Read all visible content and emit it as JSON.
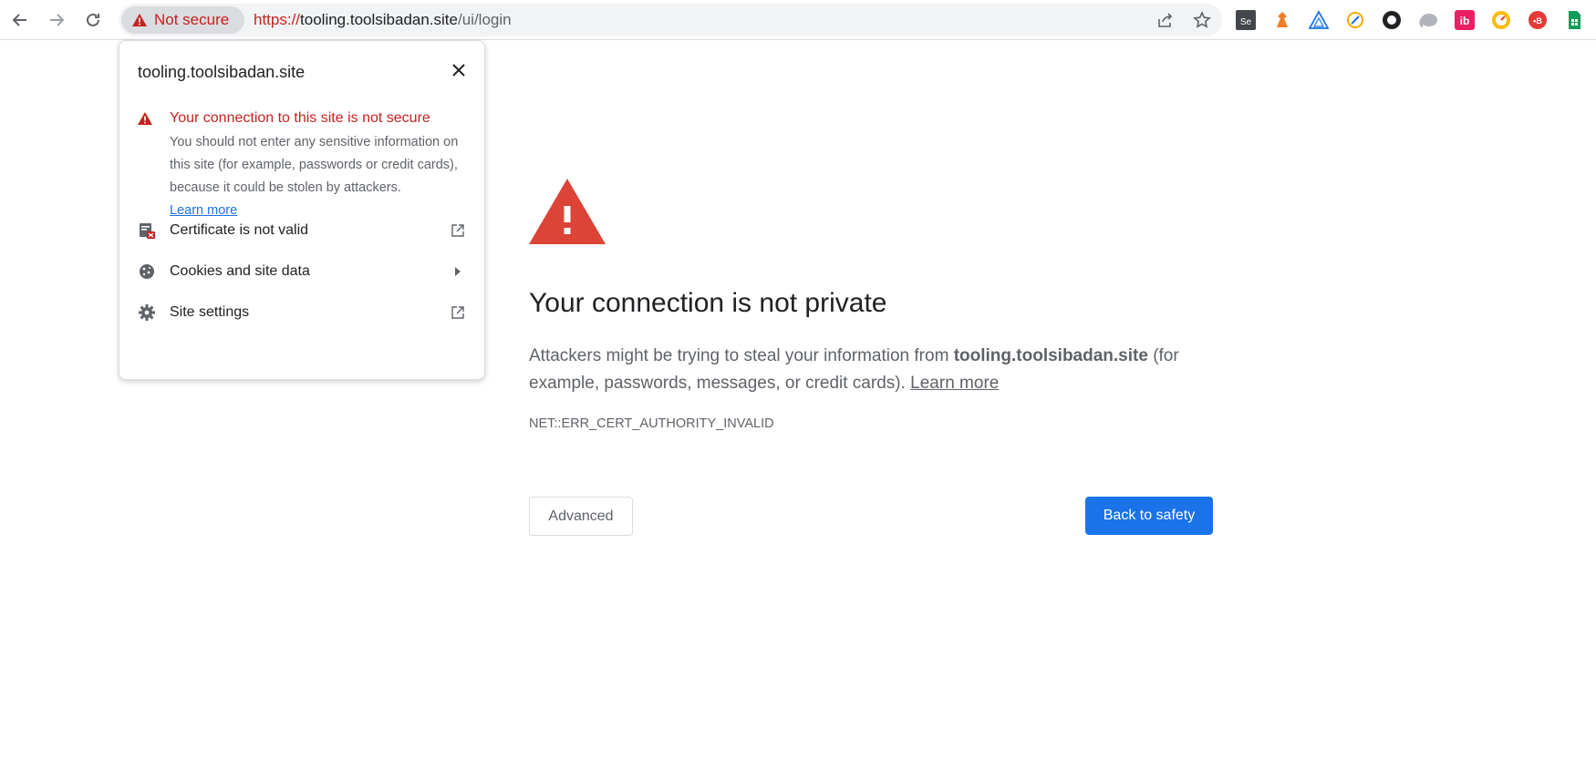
{
  "browser": {
    "security_chip": "Not secure",
    "url_scheme": "https://",
    "url_host": "tooling.toolsibadan.site",
    "url_path": "/ui/login",
    "extensions": [
      "selenium-ide-icon",
      "katalon-icon",
      "tunnel-icon",
      "recorder-icon",
      "circle-icon",
      "elephant-icon",
      "ib-icon",
      "speed-icon",
      "pb-icon",
      "sheets-icon"
    ]
  },
  "popup": {
    "title": "tooling.toolsibadan.site",
    "warning_title": "Your connection to this site is not secure",
    "warning_body": "You should not enter any sensitive information on this site (for example, passwords or credit cards), because it could be stolen by attackers.",
    "learn_more": "Learn more",
    "items": [
      {
        "label": "Certificate is not valid"
      },
      {
        "label": "Cookies and site data"
      },
      {
        "label": "Site settings"
      }
    ]
  },
  "page": {
    "title": "Your connection is not private",
    "desc_prefix": "Attackers might be trying to steal your information from ",
    "desc_host": "tooling.toolsibadan.site",
    "desc_suffix": " (for example, passwords, messages, or credit cards). ",
    "learn_more": "Learn more",
    "error_code": "NET::ERR_CERT_AUTHORITY_INVALID",
    "advanced_label": "Advanced",
    "back_label": "Back to safety"
  },
  "colors": {
    "danger": "#c5221f",
    "primary": "#1a73e8",
    "error_icon": "#db4437"
  }
}
